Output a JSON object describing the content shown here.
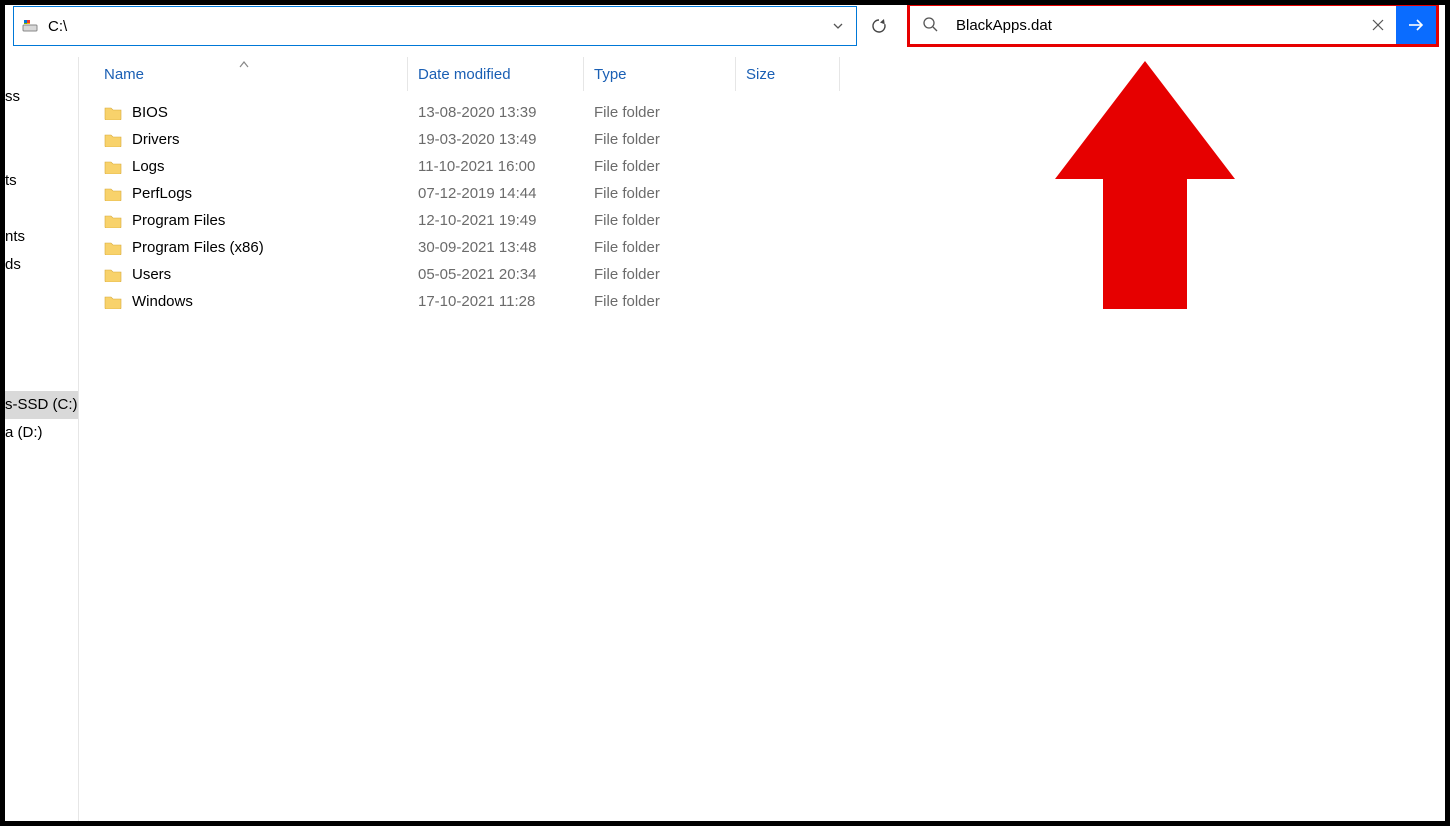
{
  "address": {
    "path": "C:\\"
  },
  "search": {
    "value": "BlackApps.dat"
  },
  "columns": {
    "name": "Name",
    "date": "Date modified",
    "type": "Type",
    "size": "Size"
  },
  "sidebar": {
    "items": [
      {
        "label": "ss"
      },
      {
        "label": ""
      },
      {
        "label": ""
      },
      {
        "label": "ts"
      },
      {
        "label": ""
      },
      {
        "label": "nts"
      },
      {
        "label": "ds"
      },
      {
        "label": ""
      },
      {
        "label": ""
      },
      {
        "label": ""
      },
      {
        "label": ""
      },
      {
        "label": "s-SSD (C:)",
        "selected": true
      },
      {
        "label": "a (D:)"
      }
    ]
  },
  "rows": [
    {
      "name": "BIOS",
      "date": "13-08-2020 13:39",
      "type": "File folder",
      "size": ""
    },
    {
      "name": "Drivers",
      "date": "19-03-2020 13:49",
      "type": "File folder",
      "size": ""
    },
    {
      "name": "Logs",
      "date": "11-10-2021 16:00",
      "type": "File folder",
      "size": ""
    },
    {
      "name": "PerfLogs",
      "date": "07-12-2019 14:44",
      "type": "File folder",
      "size": ""
    },
    {
      "name": "Program Files",
      "date": "12-10-2021 19:49",
      "type": "File folder",
      "size": ""
    },
    {
      "name": "Program Files (x86)",
      "date": "30-09-2021 13:48",
      "type": "File folder",
      "size": ""
    },
    {
      "name": "Users",
      "date": "05-05-2021 20:34",
      "type": "File folder",
      "size": ""
    },
    {
      "name": "Windows",
      "date": "17-10-2021 11:28",
      "type": "File folder",
      "size": ""
    }
  ]
}
